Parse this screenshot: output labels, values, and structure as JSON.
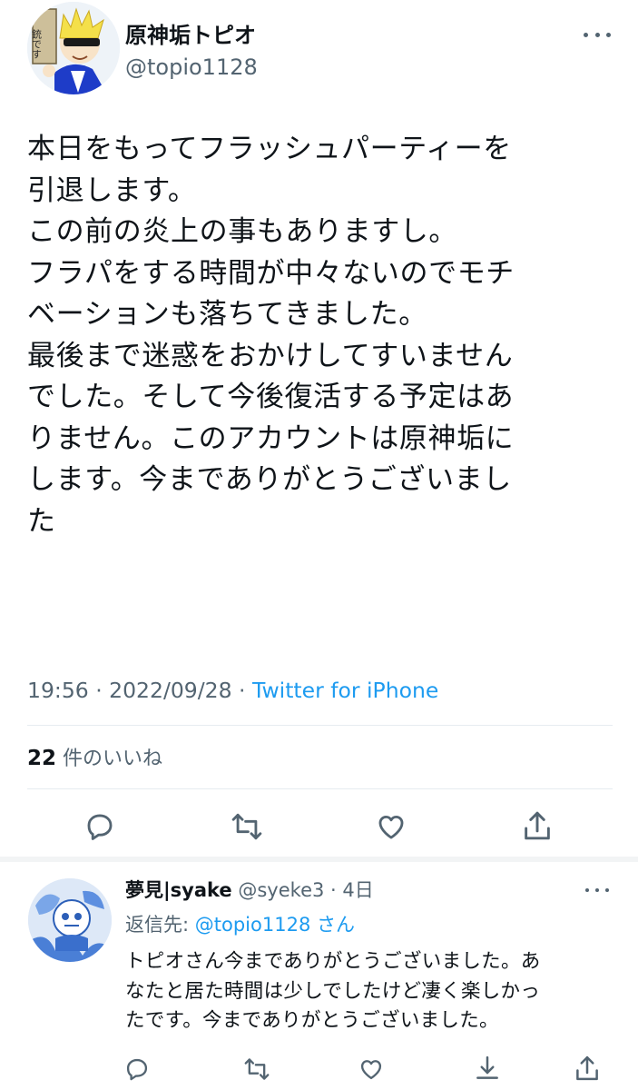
{
  "tweet": {
    "author_name": "原神垢トピオ",
    "author_handle": "@topio1128",
    "avatar_sign_text": "銃です",
    "text_lines": [
      "本日をもってフラッシュパーティーを",
      "引退します。",
      "この前の炎上の事もありますし。",
      "フラパをする時間が中々ないのでモチ",
      "ベーションも落ちてきました。",
      "最後まで迷惑をおかけしてすいません",
      "でした。そして今後復活する予定はあ",
      "りません。このアカウントは原神垢に",
      "します。今までありがとうございまし",
      "た"
    ],
    "timestamp": "19:56 · 2022/09/28 · ",
    "source": "Twitter for iPhone",
    "likes_count": "22",
    "likes_label": " 件のいいね",
    "actions": [
      "reply-icon",
      "retweet-icon",
      "like-icon",
      "share-icon"
    ]
  },
  "reply": {
    "author_name": "夢見|syake",
    "author_handle": " @syeke3 · 4日",
    "reply_to_prefix": "返信先: ",
    "reply_to_handle": "@topio1128 さん",
    "text_lines": [
      "トピオさん今までありがとうございました。あ",
      "なたと居た時間は少しでしたけど凄く楽しかっ",
      "たです。今までありがとうございました。"
    ],
    "actions": [
      "reply-icon",
      "retweet-icon",
      "like-icon",
      "download-icon",
      "share-icon"
    ]
  },
  "colors": {
    "text_primary": "#0f1419",
    "text_secondary": "#536471",
    "link": "#1d9bf0",
    "divider": "#e6ecf0"
  }
}
